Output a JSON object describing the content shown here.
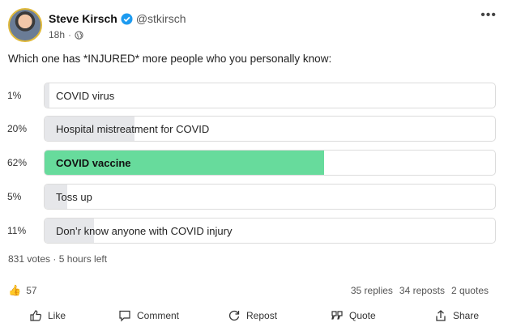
{
  "author": {
    "name": "Steve Kirsch",
    "handle": "@stkirsch",
    "time": "18h",
    "separator": "·"
  },
  "post": {
    "text": "Which one has *INJURED* more people who you personally know:"
  },
  "poll": {
    "options": [
      {
        "percent_label": "1%",
        "percent": 1,
        "label": "COVID virus"
      },
      {
        "percent_label": "20%",
        "percent": 20,
        "label": "Hospital mistreatment for COVID"
      },
      {
        "percent_label": "62%",
        "percent": 62,
        "label": "COVID vaccine",
        "winner": true
      },
      {
        "percent_label": "5%",
        "percent": 5,
        "label": "Toss up"
      },
      {
        "percent_label": "11%",
        "percent": 11,
        "label": "Don’r know anyone with COVID injury"
      }
    ],
    "summary": "831 votes · 5 hours left"
  },
  "engagement": {
    "likes": "57",
    "replies": "35 replies",
    "reposts": "34 reposts",
    "quotes": "2 quotes"
  },
  "actions": {
    "like": "Like",
    "comment": "Comment",
    "repost": "Repost",
    "quote": "Quote",
    "share": "Share"
  },
  "colors": {
    "winner_fill": "#67db9c",
    "other_fill": "#e6e7ea",
    "verified": "#1d9bf0"
  }
}
